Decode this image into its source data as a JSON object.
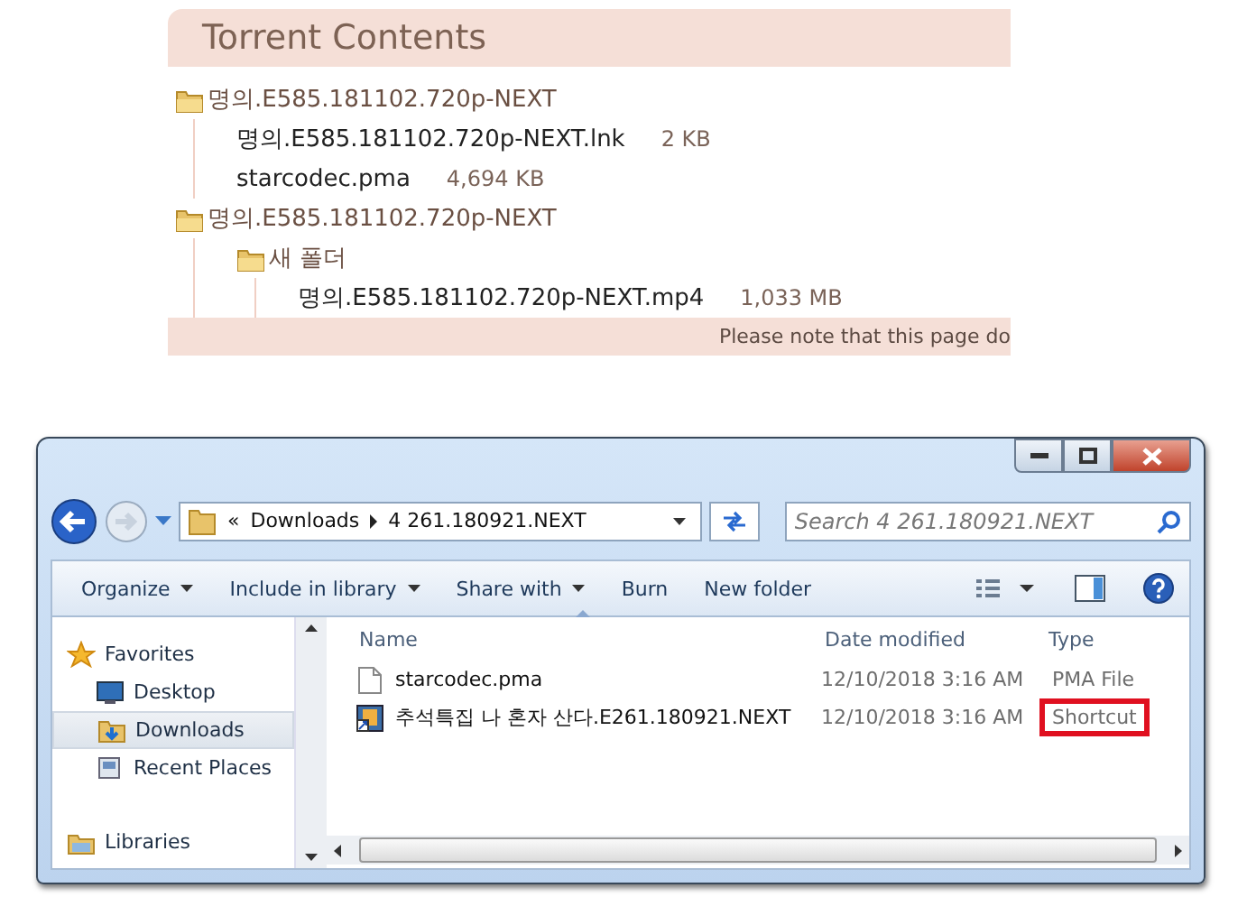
{
  "torrent": {
    "title": "Torrent Contents",
    "tree": [
      {
        "kind": "folder",
        "name": "명의.E585.181102.720p-NEXT",
        "children": [
          {
            "kind": "file",
            "name": "명의.E585.181102.720p-NEXT.lnk",
            "size": "2 KB"
          },
          {
            "kind": "file",
            "name": "starcodec.pma",
            "size": "4,694 KB"
          }
        ]
      },
      {
        "kind": "folder",
        "name": "명의.E585.181102.720p-NEXT",
        "children": [
          {
            "kind": "folder",
            "name": "새 폴더",
            "children": [
              {
                "kind": "file",
                "name": "명의.E585.181102.720p-NEXT.mp4",
                "size": "1,033 MB"
              }
            ]
          }
        ]
      }
    ],
    "note": "Please note that this page do"
  },
  "explorer": {
    "address": {
      "overflow": "«",
      "crumbs": [
        "Downloads",
        "4 261.180921.NEXT"
      ]
    },
    "search": {
      "placeholder": "Search 4 261.180921.NEXT"
    },
    "toolbar": [
      {
        "label": "Organize",
        "dropdown": true
      },
      {
        "label": "Include in library",
        "dropdown": true
      },
      {
        "label": "Share with",
        "dropdown": true
      },
      {
        "label": "Burn",
        "dropdown": false
      },
      {
        "label": "New folder",
        "dropdown": false
      }
    ],
    "nav": [
      {
        "kind": "group",
        "label": "Favorites",
        "selected": false
      },
      {
        "kind": "item",
        "label": "Desktop",
        "selected": false
      },
      {
        "kind": "item",
        "label": "Downloads",
        "selected": true
      },
      {
        "kind": "item",
        "label": "Recent Places",
        "selected": false
      },
      {
        "kind": "group",
        "label": "Libraries",
        "selected": false
      }
    ],
    "columns": [
      "Name",
      "Date modified",
      "Type"
    ],
    "files": [
      {
        "kind": "document",
        "name": "starcodec.pma",
        "date": "12/10/2018 3:16 AM",
        "type": "PMA File",
        "highlighted": false
      },
      {
        "kind": "shortcut",
        "name": "추석특집 나 혼자 산다.E261.180921.NEXT",
        "date": "12/10/2018 3:16 AM",
        "type": "Shortcut",
        "highlighted": true
      }
    ]
  }
}
